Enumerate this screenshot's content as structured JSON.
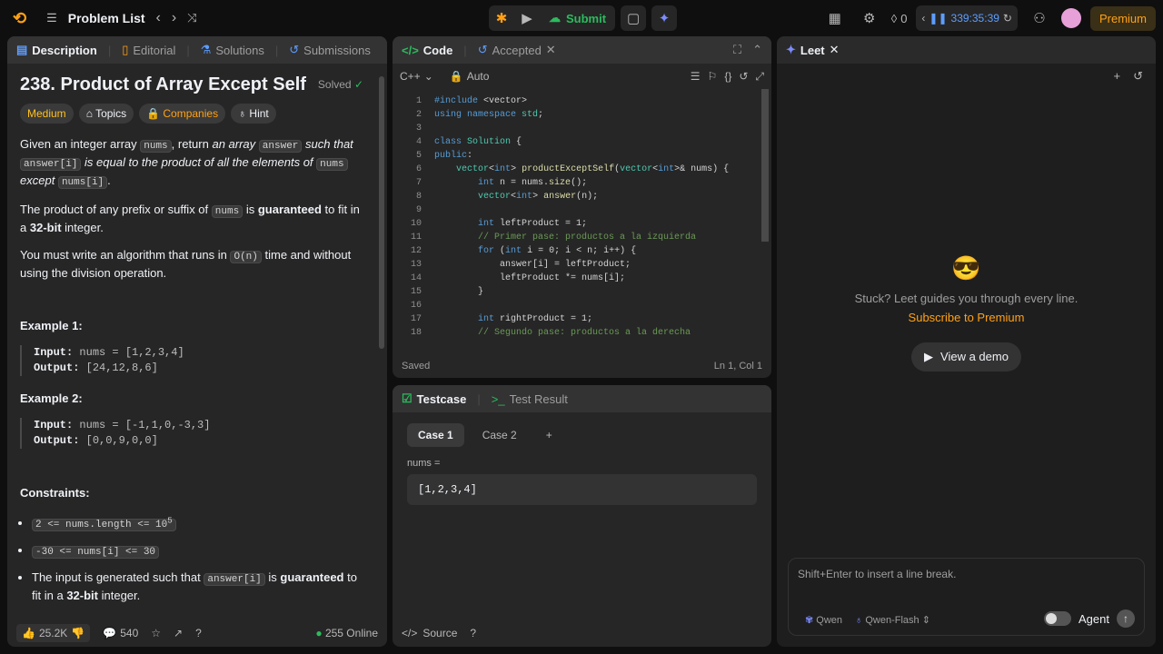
{
  "topbar": {
    "title": "Problem List",
    "submit_label": "Submit",
    "streak": "0",
    "timer": "339:35:39",
    "premium_label": "Premium"
  },
  "desc_panel": {
    "tabs": [
      "Description",
      "Editorial",
      "Solutions",
      "Submissions"
    ],
    "title": "238. Product of Array Except Self",
    "solved_label": "Solved",
    "tags": [
      "Medium",
      "Topics",
      "Companies",
      "Hint"
    ],
    "p1_a": "Given an integer array",
    "p1_code1": "nums",
    "p1_b": ", return",
    "p1_em1": "an array",
    "p1_code2": "answer",
    "p1_em2": "such that",
    "p1_code3": "answer[i]",
    "p1_em3": "is equal to the product of all the elements of",
    "p1_code4": "nums",
    "p1_em4": "except",
    "p1_code5": "nums[i]",
    "p1_end": ".",
    "p2_a": "The product of any prefix or suffix of",
    "p2_code": "nums",
    "p2_b": "is",
    "p2_strong1": "guaranteed",
    "p2_c": "to fit in a",
    "p2_strong2": "32-bit",
    "p2_d": "integer.",
    "p3_a": "You must write an algorithm that runs in",
    "p3_code": "O(n)",
    "p3_b": "time and without using the division operation.",
    "ex1_title": "Example 1:",
    "ex1_input_label": "Input:",
    "ex1_input": "nums = [1,2,3,4]",
    "ex1_output_label": "Output:",
    "ex1_output": "[24,12,8,6]",
    "ex2_title": "Example 2:",
    "ex2_input_label": "Input:",
    "ex2_input": "nums = [-1,1,0,-3,3]",
    "ex2_output_label": "Output:",
    "ex2_output": "[0,0,9,0,0]",
    "constraints_title": "Constraints:",
    "c1": "2 <= nums.length <= 10",
    "c1_exp": "5",
    "c2": "-30 <= nums[i] <= 30",
    "c3_a": "The input is generated such that",
    "c3_code": "answer[i]",
    "c3_b": "is",
    "c3_strong1": "guaranteed",
    "c3_c": "to fit in a",
    "c3_strong2": "32-bit",
    "c3_d": "integer.",
    "likes": "25.2K",
    "comments": "540",
    "online": "255 Online"
  },
  "code_panel": {
    "tab_code": "Code",
    "tab_accepted": "Accepted",
    "language": "C++",
    "auto_label": "Auto",
    "saved": "Saved",
    "cursor": "Ln 1, Col 1"
  },
  "test_panel": {
    "tab_testcase": "Testcase",
    "tab_result": "Test Result",
    "cases": [
      "Case 1",
      "Case 2"
    ],
    "var_label": "nums =",
    "var_value": "[1,2,3,4]",
    "source_label": "Source"
  },
  "leet_panel": {
    "tab": "Leet",
    "message": "Stuck? Leet guides you through every line.",
    "subscribe": "Subscribe to Premium",
    "demo": "View a demo",
    "placeholder": "Shift+Enter to insert a line break.",
    "model1": "Qwen",
    "model2": "Qwen-Flash",
    "agent": "Agent"
  }
}
